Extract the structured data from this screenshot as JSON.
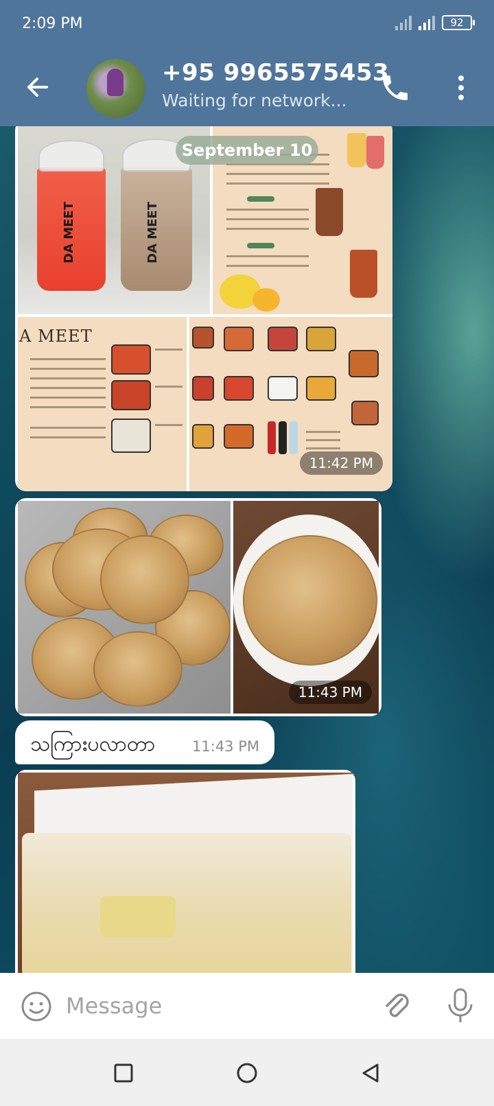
{
  "status_bar": {
    "time": "2:09 PM",
    "battery": "92"
  },
  "header": {
    "title": "+95 9965575453",
    "subtitle": "Waiting for network..."
  },
  "chat": {
    "date_label": "September 10",
    "album1": {
      "time": "11:42 PM",
      "photos": [
        "drinks-photo",
        "drinks-menu-photo",
        "noodle-menu-photo",
        "food-menu-photo"
      ],
      "menu_heading": "A MEET",
      "cup_brand": "DA MEET"
    },
    "album2": {
      "time": "11:43 PM",
      "photos": [
        "paratha-stack-photo",
        "paratha-plate-photo"
      ]
    },
    "text_message": {
      "text": "သကြားပလာတာ",
      "time": "11:43 PM"
    },
    "photo3": {
      "name": "roti-photo"
    }
  },
  "composer": {
    "placeholder": "Message"
  },
  "colors": {
    "header": "#50759b",
    "bubble": "#ffffff",
    "nav": "#f0f0f0"
  },
  "icons": [
    "back-arrow-icon",
    "phone-icon",
    "more-vertical-icon",
    "emoji-icon",
    "attach-icon",
    "mic-icon",
    "square-nav-icon",
    "circle-nav-icon",
    "triangle-nav-icon"
  ]
}
